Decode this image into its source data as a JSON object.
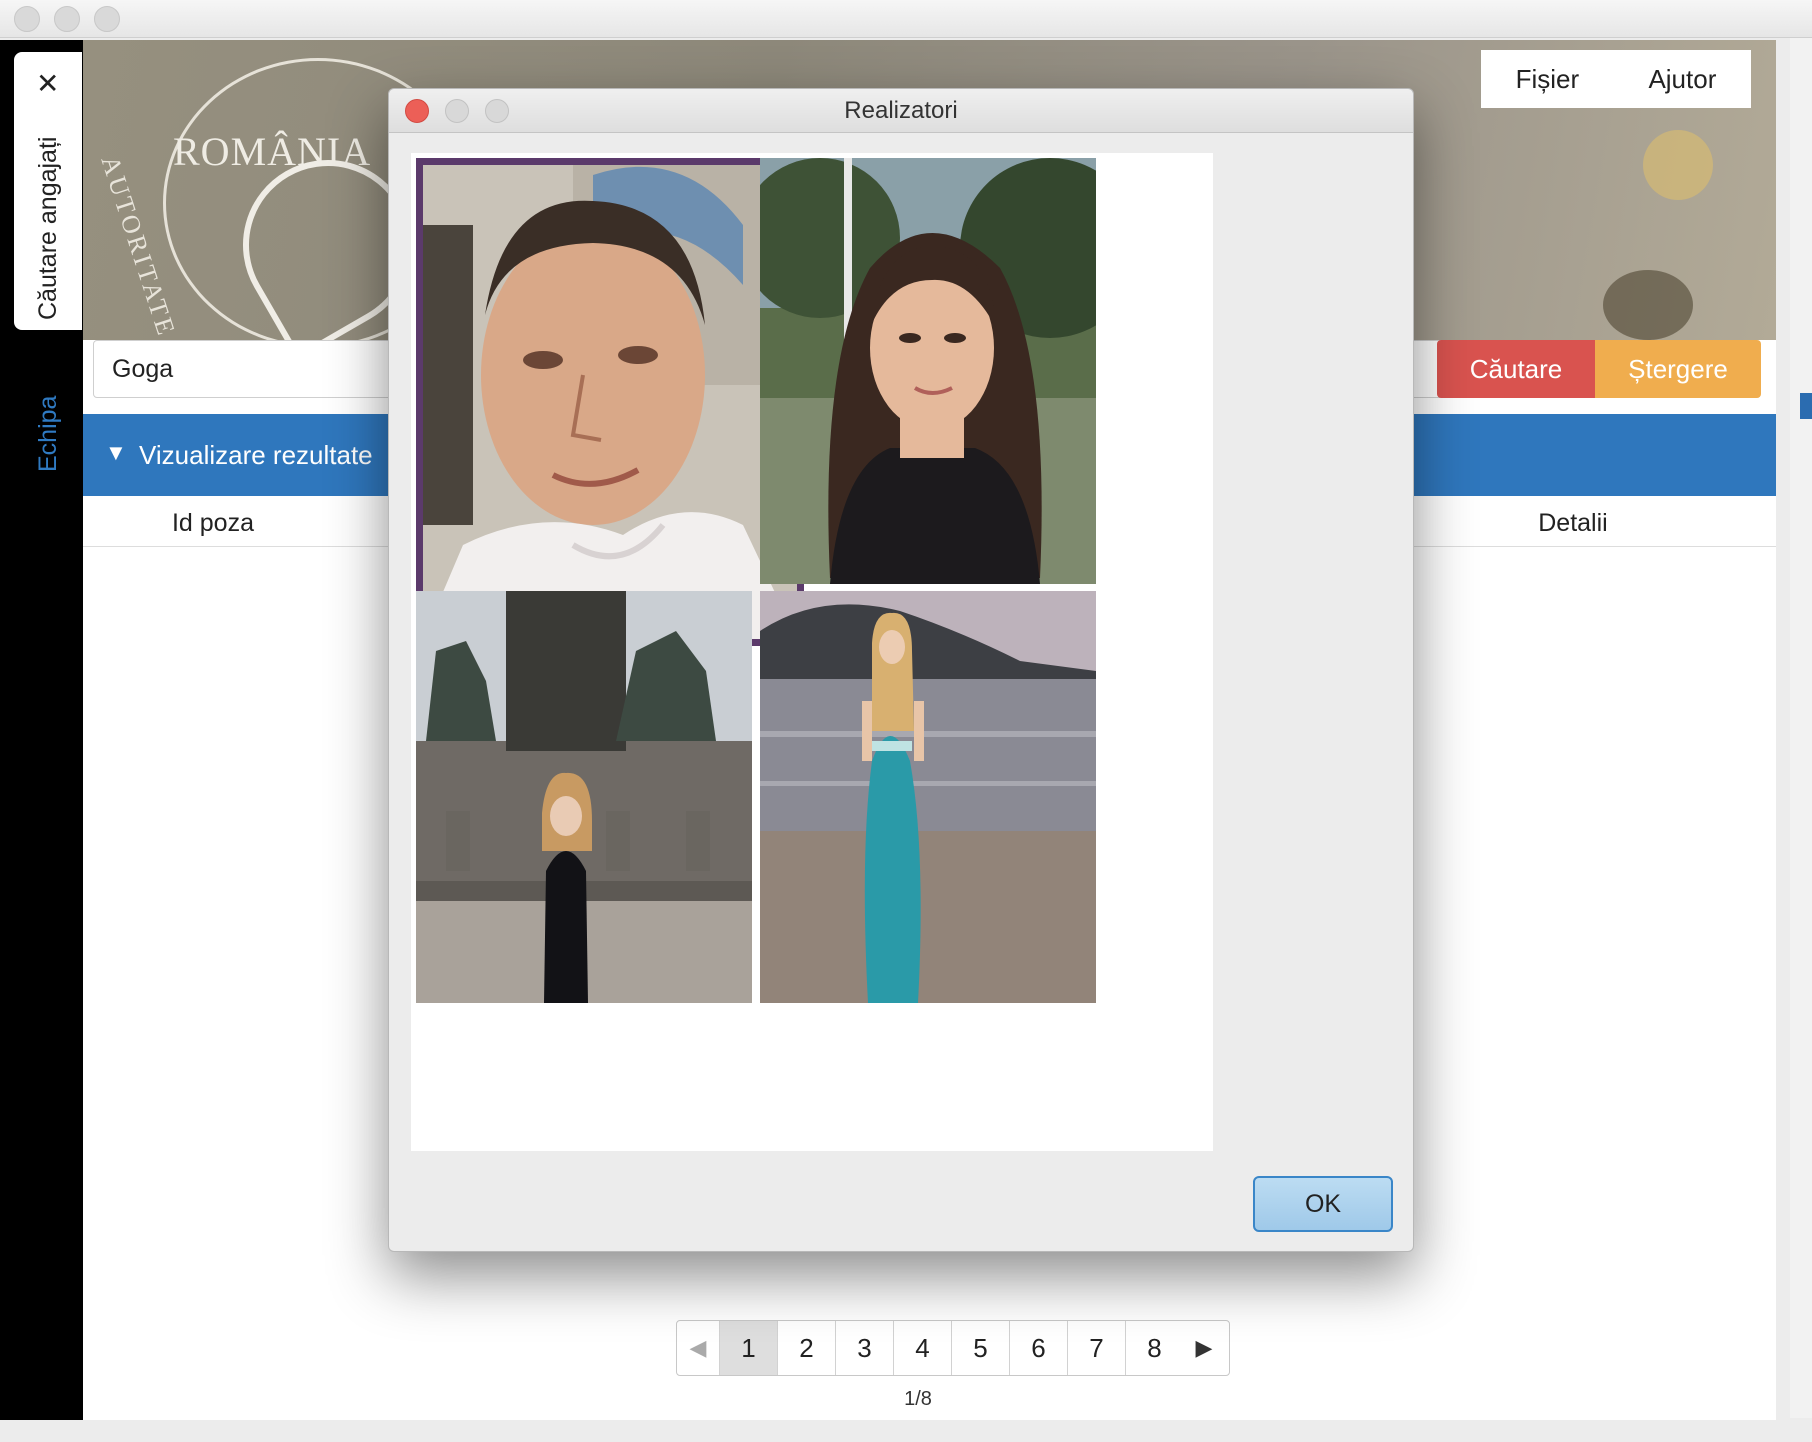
{
  "tabs": {
    "active_label": "Căutare angajați",
    "close_glyph": "✕",
    "second_label": "Echipa"
  },
  "banner": {
    "seal_text": "ROMÂNIA",
    "seal_side_text": "AUTORITATE"
  },
  "menu": {
    "items": [
      "Fișier",
      "Ajutor"
    ]
  },
  "search": {
    "value": "Goga",
    "search_button": "Căutare",
    "clear_button": "Ștergere"
  },
  "results": {
    "toggle_glyph": "▼",
    "title": "Vizualizare rezultate",
    "columns": [
      "Id poza",
      "Detalii"
    ]
  },
  "pagination": {
    "pages": [
      "1",
      "2",
      "3",
      "4",
      "5",
      "6",
      "7",
      "8"
    ],
    "active": "1",
    "prev_glyph": "◀",
    "next_glyph": "▶",
    "counter": "1/8"
  },
  "dialog": {
    "title": "Realizatori",
    "ok_button": "OK",
    "photos": [
      {
        "name": "photo-man-selfie",
        "selected": true
      },
      {
        "name": "photo-woman-park",
        "selected": false
      },
      {
        "name": "photo-woman-monument",
        "selected": false
      },
      {
        "name": "photo-woman-beach",
        "selected": false
      }
    ]
  },
  "colors": {
    "accent_blue": "#2f77bd",
    "search_red": "#d9534f",
    "clear_orange": "#f0ad4e",
    "selection_purple": "#5b3a6b"
  },
  "icons": [
    "close-icon",
    "triangle-down-icon",
    "arrow-left-icon",
    "arrow-right-icon"
  ]
}
